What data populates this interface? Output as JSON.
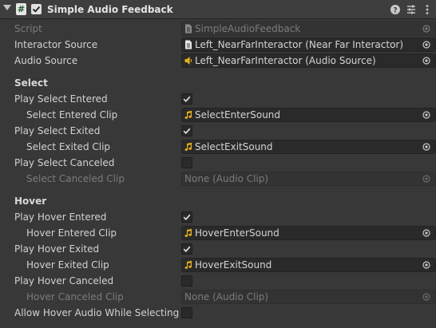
{
  "header": {
    "title": "Simple Audio Feedback",
    "enabled": true,
    "icons": [
      "script-icon",
      "help-icon",
      "settings-sliders-icon",
      "more-options-icon"
    ]
  },
  "fields": {
    "script": {
      "label": "Script",
      "value": "SimpleAudioFeedback"
    },
    "interactor_source": {
      "label": "Interactor Source",
      "value": "Left_NearFarInteractor (Near Far Interactor)"
    },
    "audio_source": {
      "label": "Audio Source",
      "value": "Left_NearFarInteractor (Audio Source)"
    }
  },
  "select": {
    "heading": "Select",
    "play_select_entered": {
      "label": "Play Select Entered",
      "checked": true
    },
    "select_entered_clip": {
      "label": "Select Entered Clip",
      "value": "SelectEnterSound"
    },
    "play_select_exited": {
      "label": "Play Select Exited",
      "checked": true
    },
    "select_exited_clip": {
      "label": "Select Exited Clip",
      "value": "SelectExitSound"
    },
    "play_select_canceled": {
      "label": "Play Select Canceled",
      "checked": false
    },
    "select_canceled_clip": {
      "label": "Select Canceled Clip",
      "value": "None (Audio Clip)"
    }
  },
  "hover": {
    "heading": "Hover",
    "play_hover_entered": {
      "label": "Play Hover Entered",
      "checked": true
    },
    "hover_entered_clip": {
      "label": "Hover Entered Clip",
      "value": "HoverEnterSound"
    },
    "play_hover_exited": {
      "label": "Play Hover Exited",
      "checked": true
    },
    "hover_exited_clip": {
      "label": "Hover Exited Clip",
      "value": "HoverExitSound"
    },
    "play_hover_canceled": {
      "label": "Play Hover Canceled",
      "checked": false
    },
    "hover_canceled_clip": {
      "label": "Hover Canceled Clip",
      "value": "None (Audio Clip)"
    },
    "allow_hover_while_selecting": {
      "label": "Allow Hover Audio While Selecting",
      "checked": false
    }
  },
  "colors": {
    "background": "#383838",
    "field_background": "#2a2a2a",
    "audio_icon": "#e8b21f",
    "disabled_text": "#7b7b7b"
  }
}
